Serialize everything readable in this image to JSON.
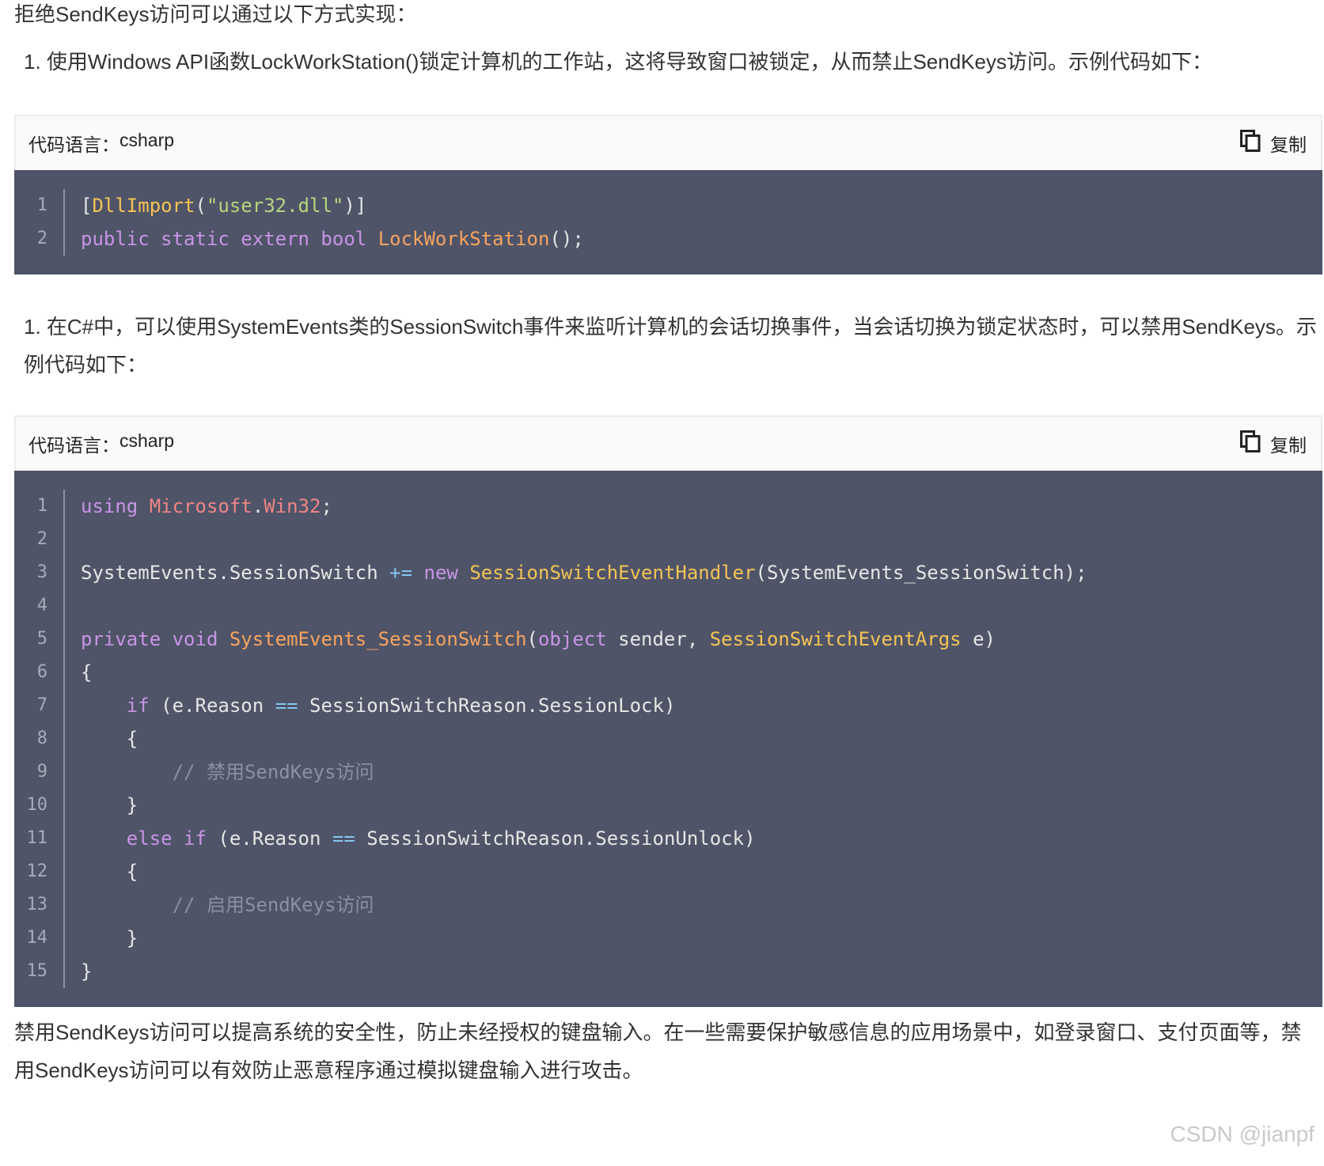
{
  "paragraphs": {
    "intro": "拒绝SendKeys访问可以通过以下方式实现：",
    "item1": "1. 使用Windows API函数LockWorkStation()锁定计算机的工作站，这将导致窗口被锁定，从而禁止SendKeys访问。示例代码如下：",
    "item2": "1. 在C#中，可以使用SystemEvents类的SessionSwitch事件来监听计算机的会话切换事件，当会话切换为锁定状态时，可以禁用SendKeys。示例代码如下：",
    "conclusion": "禁用SendKeys访问可以提高系统的安全性，防止未经授权的键盘输入。在一些需要保护敏感信息的应用场景中，如登录窗口、支付页面等，禁用SendKeys访问可以有效防止恶意程序通过模拟键盘输入进行攻击。"
  },
  "code_block_1": {
    "lang_label": "代码语言：",
    "lang": "csharp",
    "copy_label": "复制",
    "lines": [
      [
        {
          "t": "[",
          "c": ""
        },
        {
          "t": "DllImport",
          "c": "ty"
        },
        {
          "t": "(",
          "c": ""
        },
        {
          "t": "\"user32.dll\"",
          "c": "str"
        },
        {
          "t": ")]",
          "c": ""
        }
      ],
      [
        {
          "t": "public static extern bool ",
          "c": "kw"
        },
        {
          "t": "LockWorkStation",
          "c": "fn"
        },
        {
          "t": "();",
          "c": ""
        }
      ]
    ]
  },
  "code_block_2": {
    "lang_label": "代码语言：",
    "lang": "csharp",
    "copy_label": "复制",
    "lines": [
      [
        {
          "t": "using ",
          "c": "kw"
        },
        {
          "t": "Microsoft",
          "c": "ns"
        },
        {
          "t": ".",
          "c": ""
        },
        {
          "t": "Win32",
          "c": "ns"
        },
        {
          "t": ";",
          "c": ""
        }
      ],
      [],
      [
        {
          "t": "SystemEvents.SessionSwitch ",
          "c": ""
        },
        {
          "t": "+=",
          "c": "op"
        },
        {
          "t": " ",
          "c": ""
        },
        {
          "t": "new",
          "c": "kw"
        },
        {
          "t": " ",
          "c": ""
        },
        {
          "t": "SessionSwitchEventHandler",
          "c": "ty"
        },
        {
          "t": "(SystemEvents_SessionSwitch);",
          "c": ""
        }
      ],
      [],
      [
        {
          "t": "private void ",
          "c": "kw"
        },
        {
          "t": "SystemEvents_SessionSwitch",
          "c": "fn"
        },
        {
          "t": "(",
          "c": ""
        },
        {
          "t": "object",
          "c": "kw"
        },
        {
          "t": " sender, ",
          "c": ""
        },
        {
          "t": "SessionSwitchEventArgs",
          "c": "ty"
        },
        {
          "t": " e)",
          "c": ""
        }
      ],
      [
        {
          "t": "{",
          "c": ""
        }
      ],
      [
        {
          "t": "    ",
          "c": ""
        },
        {
          "t": "if",
          "c": "kw"
        },
        {
          "t": " (e.Reason ",
          "c": ""
        },
        {
          "t": "==",
          "c": "op"
        },
        {
          "t": " SessionSwitchReason.SessionLock)",
          "c": ""
        }
      ],
      [
        {
          "t": "    {",
          "c": ""
        }
      ],
      [
        {
          "t": "        ",
          "c": ""
        },
        {
          "t": "// 禁用SendKeys访问",
          "c": "cm"
        }
      ],
      [
        {
          "t": "    }",
          "c": ""
        }
      ],
      [
        {
          "t": "    ",
          "c": ""
        },
        {
          "t": "else if",
          "c": "kw"
        },
        {
          "t": " (e.Reason ",
          "c": ""
        },
        {
          "t": "==",
          "c": "op"
        },
        {
          "t": " SessionSwitchReason.SessionUnlock)",
          "c": ""
        }
      ],
      [
        {
          "t": "    {",
          "c": ""
        }
      ],
      [
        {
          "t": "        ",
          "c": ""
        },
        {
          "t": "// 启用SendKeys访问",
          "c": "cm"
        }
      ],
      [
        {
          "t": "    }",
          "c": ""
        }
      ],
      [
        {
          "t": "}",
          "c": ""
        }
      ]
    ]
  },
  "watermark": "CSDN @jianpf",
  "colors": {
    "code_bg": "#4f5468",
    "keyword": "#c795e4",
    "function": "#f7a45f",
    "type": "#f4c455",
    "string": "#b5d77e",
    "comment": "#8b8fa3"
  },
  "icons": {
    "copy": "copy-icon"
  }
}
